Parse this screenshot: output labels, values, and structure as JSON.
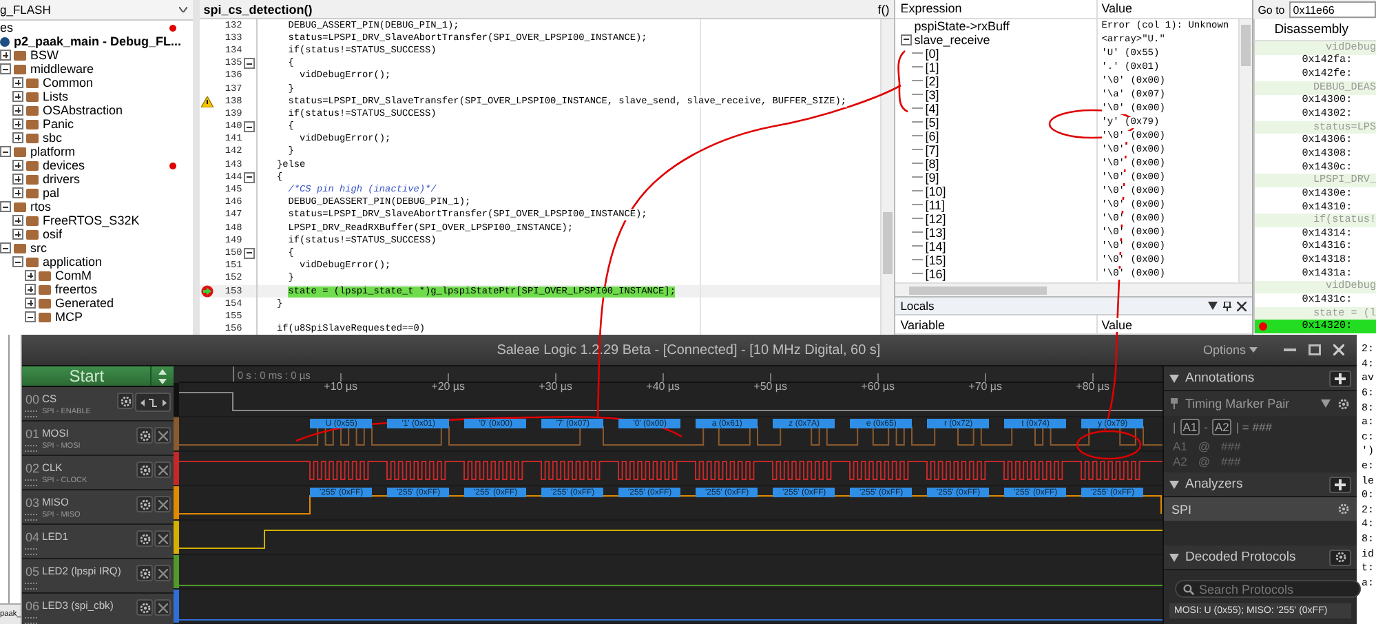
{
  "project_tree": {
    "configuration": "g_FLASH",
    "caption": "es",
    "caption_flagged": true,
    "items": [
      {
        "label": "p2_paak_main - Debug_FL...",
        "flagged": false,
        "children": [
          {
            "label": "BSW",
            "expanded": false,
            "flagged": false
          },
          {
            "label": "middleware",
            "expanded": true,
            "flagged": false,
            "children": [
              {
                "label": "Common",
                "expanded": false,
                "flagged": false
              },
              {
                "label": "Lists",
                "expanded": false,
                "flagged": false
              },
              {
                "label": "OSAbstraction",
                "expanded": false,
                "flagged": false
              },
              {
                "label": "Panic",
                "expanded": false,
                "flagged": false
              },
              {
                "label": "sbc",
                "expanded": false,
                "flagged": false
              }
            ]
          },
          {
            "label": "platform",
            "expanded": true,
            "flagged": false,
            "children": [
              {
                "label": "devices",
                "expanded": false,
                "flagged": true
              },
              {
                "label": "drivers",
                "expanded": false,
                "flagged": false
              },
              {
                "label": "pal",
                "expanded": false,
                "flagged": false
              }
            ]
          },
          {
            "label": "rtos",
            "expanded": true,
            "flagged": false,
            "children": [
              {
                "label": "FreeRTOS_S32K",
                "expanded": false,
                "flagged": false
              },
              {
                "label": "osif",
                "expanded": false,
                "flagged": false
              }
            ]
          },
          {
            "label": "src",
            "expanded": true,
            "flagged": false,
            "children": [
              {
                "label": "application",
                "expanded": true,
                "flagged": false,
                "children": [
                  {
                    "label": "ComM",
                    "expanded": false,
                    "flagged": false
                  },
                  {
                    "label": "freertos",
                    "expanded": false,
                    "flagged": false
                  },
                  {
                    "label": "Generated",
                    "expanded": false,
                    "flagged": false
                  },
                  {
                    "label": "MCP",
                    "expanded": true,
                    "flagged": false
                  }
                ]
              }
            ]
          }
        ]
      }
    ],
    "bottom_tab": "paak_"
  },
  "editor": {
    "title": "spi_cs_detection()",
    "function_button": "f()",
    "lines": [
      {
        "number": "132",
        "code": "    DEBUG_ASSERT_PIN(DEBUG_PIN_1);",
        "kind": "code",
        "fold": false,
        "highlighted": false
      },
      {
        "number": "133",
        "code": "    status=LPSPI_DRV_SlaveAbortTransfer(SPI_OVER_LPSPI00_INSTANCE);",
        "kind": "code",
        "fold": false,
        "highlighted": false
      },
      {
        "number": "134",
        "code": "    if(status!=STATUS_SUCCESS)",
        "kind": "code",
        "fold": false,
        "highlighted": false
      },
      {
        "number": "135",
        "code": "    {",
        "kind": "code",
        "fold": true,
        "highlighted": false
      },
      {
        "number": "136",
        "code": "      vidDebugError();",
        "kind": "code",
        "fold": false,
        "highlighted": false
      },
      {
        "number": "137",
        "code": "    }",
        "kind": "code",
        "fold": false,
        "highlighted": false
      },
      {
        "number": "138",
        "code": "    status=LPSPI_DRV_SlaveTransfer(SPI_OVER_LPSPI00_INSTANCE, slave_send, slave_receive, BUFFER_SIZE);",
        "kind": "warning",
        "fold": false,
        "highlighted": false
      },
      {
        "number": "139",
        "code": "    if(status!=STATUS_SUCCESS)",
        "kind": "code",
        "fold": false,
        "highlighted": false
      },
      {
        "number": "140",
        "code": "    {",
        "kind": "code",
        "fold": true,
        "highlighted": false
      },
      {
        "number": "141",
        "code": "      vidDebugError();",
        "kind": "code",
        "fold": false,
        "highlighted": false
      },
      {
        "number": "142",
        "code": "    }",
        "kind": "code",
        "fold": false,
        "highlighted": false
      },
      {
        "number": "143",
        "code": "  }else",
        "kind": "code",
        "fold": false,
        "highlighted": false
      },
      {
        "number": "144",
        "code": "  {",
        "kind": "code",
        "fold": true,
        "highlighted": false
      },
      {
        "number": "145",
        "code": "    /*CS pin high (inactive)*/",
        "kind": "comment",
        "fold": false,
        "highlighted": false
      },
      {
        "number": "146",
        "code": "    DEBUG_DEASSERT_PIN(DEBUG_PIN_1);",
        "kind": "code",
        "fold": false,
        "highlighted": false
      },
      {
        "number": "147",
        "code": "    status=LPSPI_DRV_SlaveAbortTransfer(SPI_OVER_LPSPI00_INSTANCE);",
        "kind": "code",
        "fold": false,
        "highlighted": false
      },
      {
        "number": "148",
        "code": "    LPSPI_DRV_ReadRXBuffer(SPI_OVER_LPSPI00_INSTANCE);",
        "kind": "code",
        "fold": false,
        "highlighted": false
      },
      {
        "number": "149",
        "code": "    if(status!=STATUS_SUCCESS)",
        "kind": "code",
        "fold": false,
        "highlighted": false
      },
      {
        "number": "150",
        "code": "    {",
        "kind": "code",
        "fold": true,
        "highlighted": false
      },
      {
        "number": "151",
        "code": "      vidDebugError();",
        "kind": "code",
        "fold": false,
        "highlighted": false
      },
      {
        "number": "152",
        "code": "    }",
        "kind": "code",
        "fold": false,
        "highlighted": false
      },
      {
        "number": "153",
        "code": "    state = (lpspi_state_t *)g_lpspiStatePtr[SPI_OVER_LPSPI00_INSTANCE];",
        "kind": "breakpoint",
        "fold": false,
        "highlighted": true
      },
      {
        "number": "154",
        "code": "  }",
        "kind": "code",
        "fold": false,
        "highlighted": false
      },
      {
        "number": "155",
        "kind": "code",
        "fold": false,
        "highlighted": false
      },
      {
        "number": "156",
        "code": "  if(u8SpiSlaveRequested==0)",
        "kind": "code",
        "fold": false,
        "highlighted": false
      }
    ]
  },
  "expressions": {
    "columns": [
      "Expression",
      "Value"
    ],
    "rows": [
      {
        "name": "pspiState->rxBuff",
        "value": "Error (col 1): Unknown"
      },
      {
        "name": "slave_receive",
        "value": "<array>\"U.\"",
        "expanded": true,
        "children": [
          {
            "name": "[0]",
            "value": "'U' (0x55)"
          },
          {
            "name": "[1]",
            "value": "'.' (0x01)"
          },
          {
            "name": "[2]",
            "value": "'\\0' (0x00)"
          },
          {
            "name": "[3]",
            "value": "'\\a' (0x07)"
          },
          {
            "name": "[4]",
            "value": "'\\0' (0x00)"
          },
          {
            "name": "[5]",
            "value": "'y' (0x79)"
          },
          {
            "name": "[6]",
            "value": "'\\0' (0x00)"
          },
          {
            "name": "[7]",
            "value": "'\\0' (0x00)"
          },
          {
            "name": "[8]",
            "value": "'\\0' (0x00)"
          },
          {
            "name": "[9]",
            "value": "'\\0' (0x00)"
          },
          {
            "name": "[10]",
            "value": "'\\0' (0x00)"
          },
          {
            "name": "[11]",
            "value": "'\\0' (0x00)"
          },
          {
            "name": "[12]",
            "value": "'\\0' (0x00)"
          },
          {
            "name": "[13]",
            "value": "'\\0' (0x00)"
          },
          {
            "name": "[14]",
            "value": "'\\0' (0x00)"
          },
          {
            "name": "[15]",
            "value": "'\\0' (0x00)"
          },
          {
            "name": "[16]",
            "value": "'\\0' (0x00)"
          }
        ]
      }
    ]
  },
  "locals": {
    "title": "Locals",
    "columns": [
      "Variable",
      "Value"
    ]
  },
  "disassembly": {
    "goto_label": "Go to",
    "goto_value": "0x11e66",
    "title": "Disassembly",
    "lines": [
      {
        "kind": "source",
        "text": "vidDebug"
      },
      {
        "kind": "address",
        "text": "0x142fa:"
      },
      {
        "kind": "address",
        "text": "0x142fe:"
      },
      {
        "kind": "source",
        "text": "DEBUG_DEAS"
      },
      {
        "kind": "address",
        "text": "0x14300:"
      },
      {
        "kind": "address",
        "text": "0x14302:"
      },
      {
        "kind": "source",
        "text": "status=LPS"
      },
      {
        "kind": "address",
        "text": "0x14306:"
      },
      {
        "kind": "address",
        "text": "0x14308:"
      },
      {
        "kind": "address",
        "text": "0x1430c:"
      },
      {
        "kind": "source",
        "text": "LPSPI_DRV_"
      },
      {
        "kind": "address",
        "text": "0x1430e:"
      },
      {
        "kind": "address",
        "text": "0x14310:"
      },
      {
        "kind": "source",
        "text": "if(status!"
      },
      {
        "kind": "address",
        "text": "0x14314:"
      },
      {
        "kind": "address",
        "text": "0x14316:"
      },
      {
        "kind": "address",
        "text": "0x14318:"
      },
      {
        "kind": "address",
        "text": "0x1431a:"
      },
      {
        "kind": "source",
        "text": "vidDebug"
      },
      {
        "kind": "address",
        "text": "0x1431c:"
      },
      {
        "kind": "source",
        "text": "state = (l"
      },
      {
        "kind": "current",
        "text": "0x14320:"
      }
    ],
    "tail": [
      "2:",
      "4:",
      "av",
      "6:",
      "8:",
      "a:",
      "c:",
      "')",
      "e:",
      "le",
      "0:",
      "2:",
      "4:",
      "8:",
      "id",
      "t:",
      "a:"
    ]
  },
  "saleae": {
    "title": "Saleae Logic 1.2.29 Beta - [Connected] - [10 MHz Digital, 60 s]",
    "options": "Options",
    "start": "Start",
    "time_origin": "0 s : 0 ms : 0 µs",
    "ticks": [
      "+10 µs",
      "+20 µs",
      "+30 µs",
      "+40 µs",
      "+50 µs",
      "+60 µs",
      "+70 µs",
      "+80 µs"
    ],
    "channels": [
      {
        "number": "00",
        "name": "CS",
        "subtitle": "SPI - ENABLE",
        "kind": "enable",
        "color": "#111111"
      },
      {
        "number": "01",
        "name": "MOSI",
        "subtitle": "SPI - MOSI",
        "kind": "data",
        "color": "#8a5a2e",
        "decoded": [
          "U (0x55)",
          "'1' (0x01)",
          "'0' (0x00)",
          "'7' (0x07)",
          "'0' (0x00)",
          "a (0x61)",
          "z (0x7A)",
          "e (0x65)",
          "r (0x72)",
          "t (0x74)",
          "y (0x79)"
        ]
      },
      {
        "number": "02",
        "name": "CLK",
        "subtitle": "SPI - CLOCK",
        "kind": "clock",
        "color": "#c62828"
      },
      {
        "number": "03",
        "name": "MISO",
        "subtitle": "SPI - MISO",
        "kind": "rise",
        "color": "#e08a00",
        "decoded": [
          "'255' (0xFF)",
          "'255' (0xFF)",
          "'255' (0xFF)",
          "'255' (0xFF)",
          "'255' (0xFF)",
          "'255' (0xFF)",
          "'255' (0xFF)",
          "'255' (0xFF)",
          "'255' (0xFF)",
          "'255' (0xFF)",
          "'255' (0xFF)"
        ]
      },
      {
        "number": "04",
        "name": "LED1",
        "kind": "step",
        "color": "#d4b000"
      },
      {
        "number": "05",
        "name": "LED2 (lpspi IRQ)",
        "kind": "flat",
        "color": "#4f9a2a"
      },
      {
        "number": "06",
        "name": "LED3 (spi_cbk)",
        "kind": "flat",
        "color": "#2f6fd6"
      }
    ],
    "annotations": {
      "title": "Annotations",
      "marker_pair": "Timing Marker Pair",
      "formula": {
        "open": "|",
        "a": "A1",
        "op": "-",
        "b": "A2",
        "rest": "| = ###"
      },
      "markers": [
        {
          "label": "A1",
          "at": "@",
          "value": "###"
        },
        {
          "label": "A2",
          "at": "@",
          "value": "###"
        }
      ]
    },
    "analyzers": {
      "title": "Analyzers",
      "items": [
        "SPI"
      ]
    },
    "decoded": {
      "title": "Decoded Protocols",
      "search_placeholder": "Search Protocols",
      "rows": [
        "MOSI: U (0x55);  MISO: '255' (0xFF)"
      ]
    }
  }
}
